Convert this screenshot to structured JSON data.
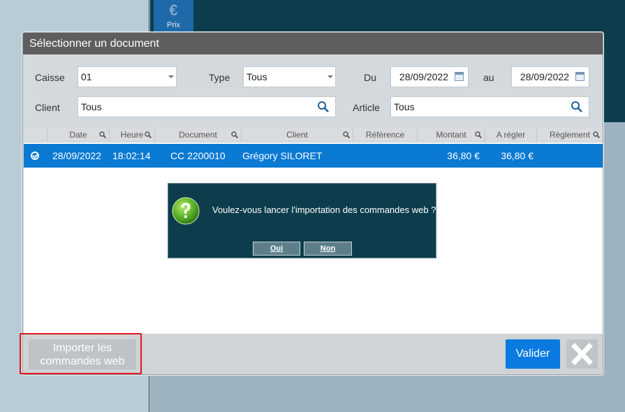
{
  "background": {
    "price_label": "Prix",
    "price_icon": "euro-icon"
  },
  "dialog": {
    "title": "Sélectionner un document",
    "filters": {
      "caisse_label": "Caisse",
      "caisse_value": "01",
      "type_label": "Type",
      "type_value": "Tous",
      "du_label": "Du",
      "du_value": "28/09/2022",
      "au_label": "au",
      "au_value": "28/09/2022",
      "client_label": "Client",
      "client_value": "Tous",
      "article_label": "Article",
      "article_value": "Tous"
    },
    "grid": {
      "columns": [
        "Date",
        "Heure",
        "Document",
        "Client",
        "Référence",
        "Montant",
        "A régler",
        "Règlement"
      ],
      "rows": [
        {
          "date": "28/09/2022",
          "heure": "18:02:14",
          "document": "CC 2200010",
          "client": "Grégory SILORET",
          "reference": "",
          "montant": "36,80 €",
          "a_regler": "36,80 €",
          "reglement": ""
        }
      ]
    },
    "confirm": {
      "message": "Voulez-vous lancer l'importation des commandes web ?",
      "oui": "Oui",
      "non": "Non",
      "icon": "question-icon"
    },
    "footer": {
      "import_label_line1": "Importer les",
      "import_label_line2": "commandes web",
      "valider_label": "Valider",
      "close_icon": "close-icon"
    }
  },
  "colors": {
    "accent": "#0a7ad3",
    "title_bar": "#5e5e5e",
    "popup_bg": "#0d3d4c",
    "highlight": "#e0161c"
  }
}
